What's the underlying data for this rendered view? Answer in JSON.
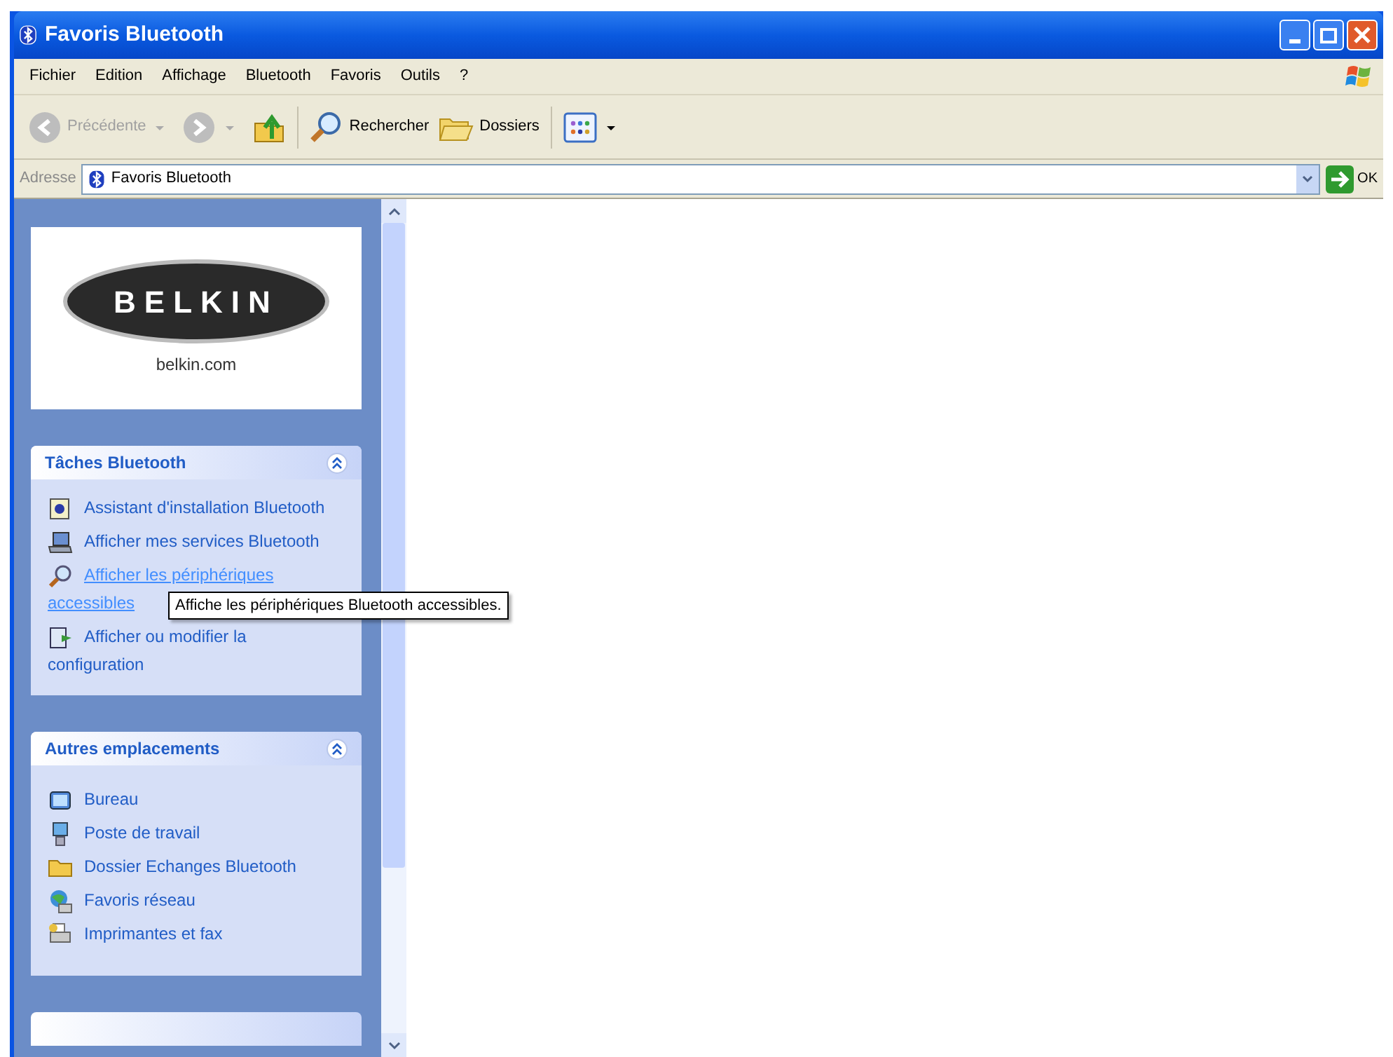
{
  "window": {
    "title": "Favoris Bluetooth"
  },
  "menu": [
    "Fichier",
    "Edition",
    "Affichage",
    "Bluetooth",
    "Favoris",
    "Outils",
    "?"
  ],
  "toolbar": [
    {
      "kind": "back",
      "label": "Précédente",
      "disabled": true
    },
    {
      "kind": "forward",
      "disabled": true
    },
    {
      "kind": "up"
    },
    {
      "kind": "search",
      "label": "Rechercher"
    },
    {
      "kind": "folders",
      "label": "Dossiers"
    },
    {
      "kind": "views"
    }
  ],
  "address": {
    "label": "Adresse",
    "value": "Favoris Bluetooth",
    "go": "OK"
  },
  "sidebar": {
    "logo": {
      "brand": "BELKIN",
      "url": "belkin.com"
    },
    "panels": [
      {
        "title": "Tâches Bluetooth",
        "expanded": true,
        "items": [
          {
            "kind": "wizard",
            "label": "Assistant d'installation Bluetooth",
            "hovered": false
          },
          {
            "kind": "laptop",
            "label": "Afficher mes services Bluetooth",
            "hovered": false
          },
          {
            "kind": "search",
            "label": "Afficher les périphériques accessibles",
            "hovered": true
          },
          {
            "kind": "config",
            "label": "Afficher ou modifier la configuration",
            "hovered": false
          }
        ]
      },
      {
        "title": "Autres emplacements",
        "expanded": true,
        "items": [
          {
            "kind": "desktop",
            "label": "Bureau",
            "hovered": false
          },
          {
            "kind": "computer",
            "label": "Poste de travail",
            "hovered": false
          },
          {
            "kind": "folder",
            "label": "Dossier Echanges Bluetooth",
            "hovered": false
          },
          {
            "kind": "network",
            "label": "Favoris réseau",
            "hovered": false
          },
          {
            "kind": "printer",
            "label": "Imprimantes et fax",
            "hovered": false
          }
        ]
      }
    ]
  },
  "tooltip": "Affiche les périphériques Bluetooth accessibles."
}
